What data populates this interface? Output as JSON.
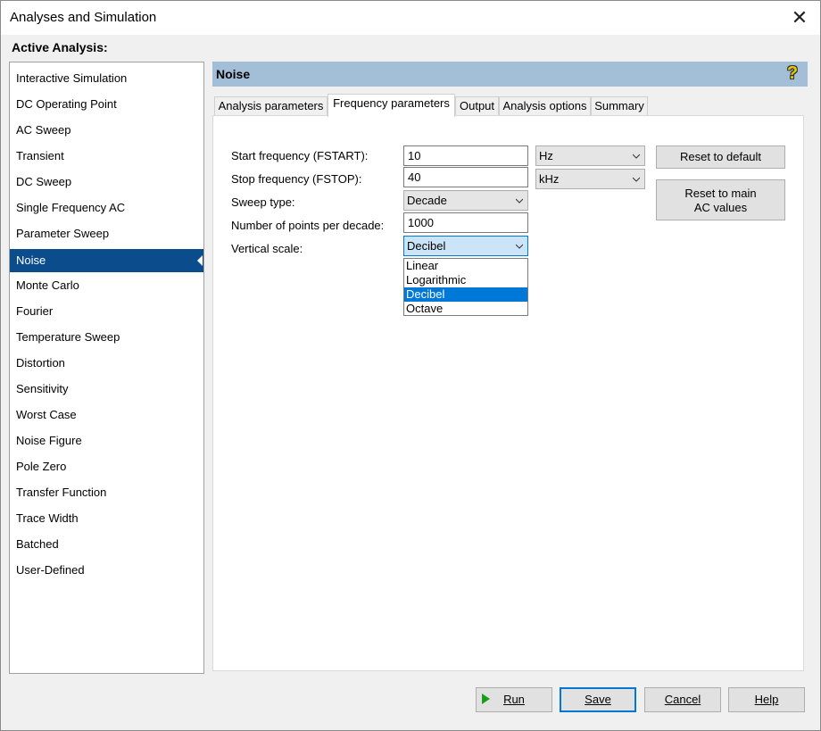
{
  "window": {
    "title": "Analyses and Simulation",
    "close_glyph": "✕"
  },
  "active_analysis_label": "Active Analysis:",
  "analyses": [
    "Interactive Simulation",
    "DC Operating Point",
    "AC Sweep",
    "Transient",
    "DC Sweep",
    "Single Frequency AC",
    "Parameter Sweep",
    "Noise",
    "Monte Carlo",
    "Fourier",
    "Temperature Sweep",
    "Distortion",
    "Sensitivity",
    "Worst Case",
    "Noise Figure",
    "Pole Zero",
    "Transfer Function",
    "Trace Width",
    "Batched",
    "User-Defined"
  ],
  "selected_analysis": "Noise",
  "panel": {
    "title": "Noise",
    "help_glyph": "?"
  },
  "tabs": [
    "Analysis parameters",
    "Frequency parameters",
    "Output",
    "Analysis options",
    "Summary"
  ],
  "active_tab": "Frequency parameters",
  "form": {
    "start_label": "Start frequency (FSTART):",
    "start_value": "10",
    "start_unit": "Hz",
    "stop_label": "Stop frequency (FSTOP):",
    "stop_value": "40",
    "stop_unit": "kHz",
    "sweep_label": "Sweep type:",
    "sweep_value": "Decade",
    "points_label": "Number of points per decade:",
    "points_value": "1000",
    "scale_label": "Vertical scale:",
    "scale_value": "Decibel",
    "scale_options": [
      "Linear",
      "Logarithmic",
      "Decibel",
      "Octave"
    ]
  },
  "side_buttons": {
    "reset_default": "Reset to default",
    "reset_main_line1": "Reset to main",
    "reset_main_line2": "AC values"
  },
  "footer": {
    "run": "Run",
    "save": "Save",
    "cancel": "Cancel",
    "help": "Help"
  },
  "colors": {
    "selected_item": "#0b4c8c",
    "panel_header": "#a2bfd7",
    "dropdown_highlight": "#0078d7",
    "run_icon": "#1a9e1a"
  }
}
